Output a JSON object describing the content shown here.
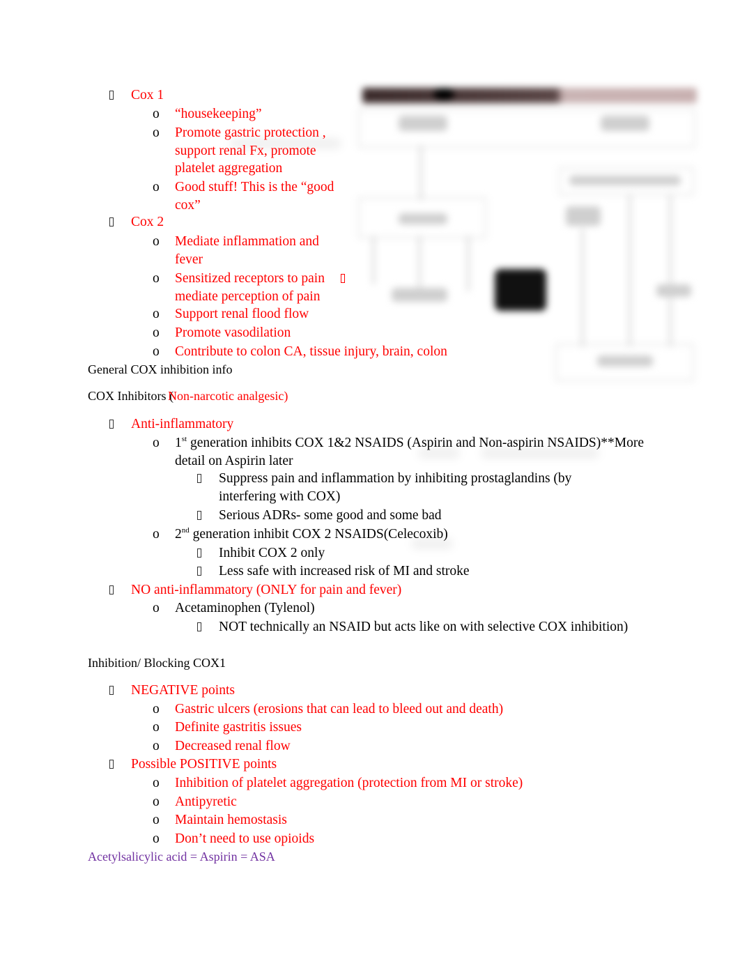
{
  "document": {
    "cox1": {
      "heading": "Cox 1",
      "items": [
        "“housekeeping”",
        "Promote gastric protection  ,",
        "support renal Fx, promote",
        "platelet aggregation",
        "Good stuff!  This is the “good",
        "cox”"
      ]
    },
    "cox2": {
      "heading": "Cox 2",
      "items": [
        "Mediate inflammation and",
        "fever",
        "Sensitized receptors to pain",
        "mediate perception of pain",
        "Support renal flood flow",
        "Promote vasodilation",
        "Contribute to colon CA, tissue injury, brain, colon"
      ]
    },
    "general_heading": "General COX inhibition info",
    "inhibitors_heading": {
      "black": "COX Inhibitors (",
      "red": "Non-narcotic analgesic)"
    },
    "anti_inflammatory": {
      "heading": "Anti-inflammatory",
      "gen1": {
        "num": "1",
        "sup": "st",
        "text": " generation inhibits COX 1&2 NSAIDS (Aspirin and Non-aspirin NSAIDS)**More",
        "cont": "detail on Aspirin later",
        "subitems": [
          "Suppress pain and inflammation by inhibiting prostaglandins (by",
          "interfering with COX)",
          "Serious ADRs- some good and some bad"
        ]
      },
      "gen2": {
        "num": "2",
        "sup": "nd",
        "text": " generation inhibit COX 2 NSAIDS(Celecoxib)",
        "subitems": [
          "Inhibit COX 2 only",
          "Less safe with increased risk of MI and stroke"
        ]
      }
    },
    "no_anti_inflammatory": {
      "heading": "NO anti-inflammatory (ONLY for pain and fever)",
      "item": "Acetaminophen (Tylenol)",
      "subitem": "NOT technically an NSAID but acts like on with selective COX inhibition)"
    },
    "inhibition_heading": "Inhibition/ Blocking COX1",
    "negative": {
      "heading": "NEGATIVE points",
      "items": [
        "Gastric ulcers (erosions that can lead to bleed out and death)",
        "Definite gastritis issues",
        "Decreased renal flow"
      ]
    },
    "positive": {
      "heading": "Possible POSITIVE points",
      "items": [
        "Inhibition of platelet aggregation (protection from MI or stroke)",
        "Antipyretic",
        "Maintain hemostasis",
        "Don’t need to use opioids"
      ]
    },
    "aspirin_line": "Acetylsalicylic acid = Aspirin = ASA",
    "bullet_o": "o"
  },
  "colors": {
    "red": "#ff0000",
    "purple": "#7030a0",
    "text": "#000000"
  }
}
